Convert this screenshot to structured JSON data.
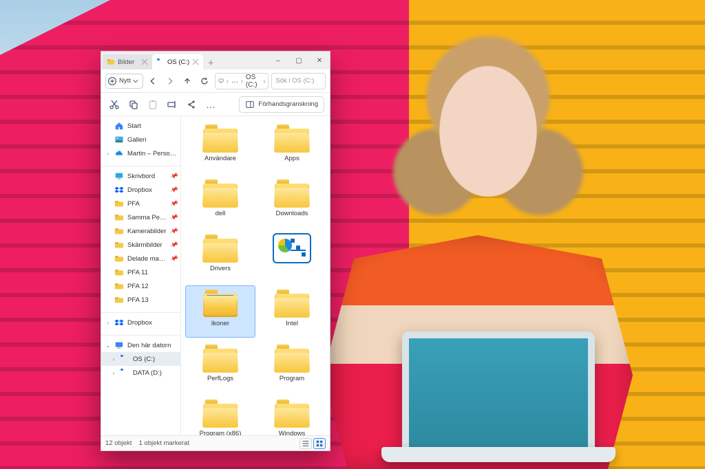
{
  "tabs": [
    {
      "title": "Bilder",
      "active": false,
      "icon": "folder"
    },
    {
      "title": "OS (C:)",
      "active": true,
      "icon": "drive"
    }
  ],
  "window": {
    "new_button": "Nytt",
    "min": "–",
    "max": "▢",
    "close": "✕",
    "plus": "＋"
  },
  "addressbar": {
    "ellipsis": "…",
    "segment": "OS (C:)"
  },
  "search": {
    "placeholder": "Sök i OS (C:)"
  },
  "toolbar": {
    "preview_label": "Förhandsgranskning",
    "more": "…"
  },
  "nav": {
    "top": [
      {
        "label": "Start",
        "icon": "home",
        "exp": ""
      },
      {
        "label": "Galleri",
        "icon": "gallery",
        "exp": ""
      },
      {
        "label": "Martin – Personligt",
        "icon": "onedrive",
        "exp": "›"
      }
    ],
    "quick": [
      {
        "label": "Skrivbord",
        "icon": "desktop",
        "pinned": true
      },
      {
        "label": "Dropbox",
        "icon": "dropbox",
        "pinned": true
      },
      {
        "label": "PFA",
        "icon": "folder",
        "pinned": true
      },
      {
        "label": "Samma Per…",
        "icon": "folder",
        "pinned": true
      },
      {
        "label": "Kamerabilder",
        "icon": "folder",
        "pinned": true
      },
      {
        "label": "Skärmbilder",
        "icon": "folder",
        "pinned": true
      },
      {
        "label": "Delade mappar",
        "icon": "folder",
        "pinned": true
      },
      {
        "label": "PFA 11",
        "icon": "folder",
        "pinned": false
      },
      {
        "label": "PFA 12",
        "icon": "folder",
        "pinned": false
      },
      {
        "label": "PFA 13",
        "icon": "folder",
        "pinned": false
      }
    ],
    "dropbox": {
      "label": "Dropbox",
      "exp": "›"
    },
    "thispc": {
      "label": "Den här datorn",
      "exp": "⌄"
    },
    "drives": [
      {
        "label": "OS (C:)",
        "selected": true,
        "exp": "›"
      },
      {
        "label": "DATA (D:)",
        "selected": false,
        "exp": "›"
      }
    ]
  },
  "items": [
    {
      "label": "Användare",
      "kind": "folder"
    },
    {
      "label": "Apps",
      "kind": "folder"
    },
    {
      "label": "dell",
      "kind": "folder"
    },
    {
      "label": "Downloads",
      "kind": "folder"
    },
    {
      "label": "Drivers",
      "kind": "folder"
    },
    {
      "label": "",
      "kind": "godmode"
    },
    {
      "label": "Ikoner",
      "kind": "folder-open",
      "selected": true
    },
    {
      "label": "Intel",
      "kind": "folder"
    },
    {
      "label": "PerfLogs",
      "kind": "folder"
    },
    {
      "label": "Program",
      "kind": "folder"
    },
    {
      "label": "Program (x86)",
      "kind": "folder"
    },
    {
      "label": "Windows",
      "kind": "folder"
    }
  ],
  "status": {
    "count": "12 objekt",
    "selected": "1 objekt markerat"
  }
}
